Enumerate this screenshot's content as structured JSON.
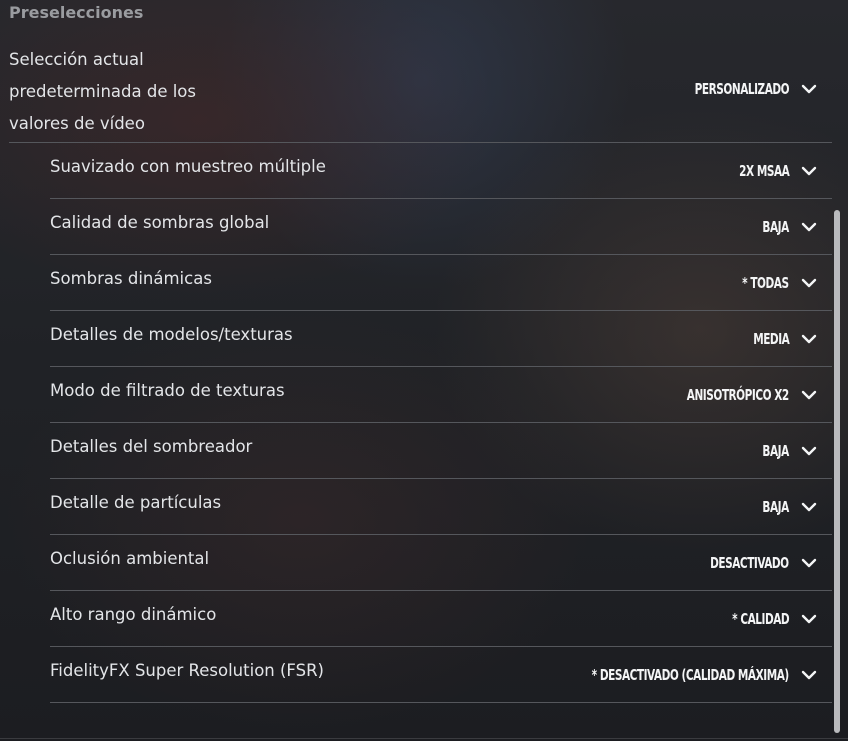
{
  "section": {
    "title": "Preselecciones"
  },
  "preset": {
    "label_line1": "Selección actual",
    "label_line2": "predeterminada de los",
    "label_line3": "valores de vídeo",
    "value": "PERSONALIZADO",
    "icon": "chevron-down-icon"
  },
  "settings": [
    {
      "label": "Suavizado con muestreo múltiple",
      "value": "2X MSAA"
    },
    {
      "label": "Calidad de sombras global",
      "value": "BAJA"
    },
    {
      "label": "Sombras dinámicas",
      "value": "* TODAS"
    },
    {
      "label": "Detalles de modelos/texturas",
      "value": "MEDIA"
    },
    {
      "label": "Modo de filtrado de texturas",
      "value": "ANISOTRÓPICO X2"
    },
    {
      "label": "Detalles del sombreador",
      "value": "BAJA"
    },
    {
      "label": "Detalle de partículas",
      "value": "BAJA"
    },
    {
      "label": "Oclusión ambiental",
      "value": "DESACTIVADO"
    },
    {
      "label": "Alto rango dinámico",
      "value": "* CALIDAD"
    },
    {
      "label": "FidelityFX Super Resolution (FSR)",
      "value": "* DESACTIVADO (CALIDAD MÁXIMA)"
    }
  ],
  "colors": {
    "text": "#e3e5e8",
    "value_text": "#f4f5f6",
    "title": "#9a9ca0",
    "divider": "#55575c",
    "scrollbar": "#b9babd"
  }
}
